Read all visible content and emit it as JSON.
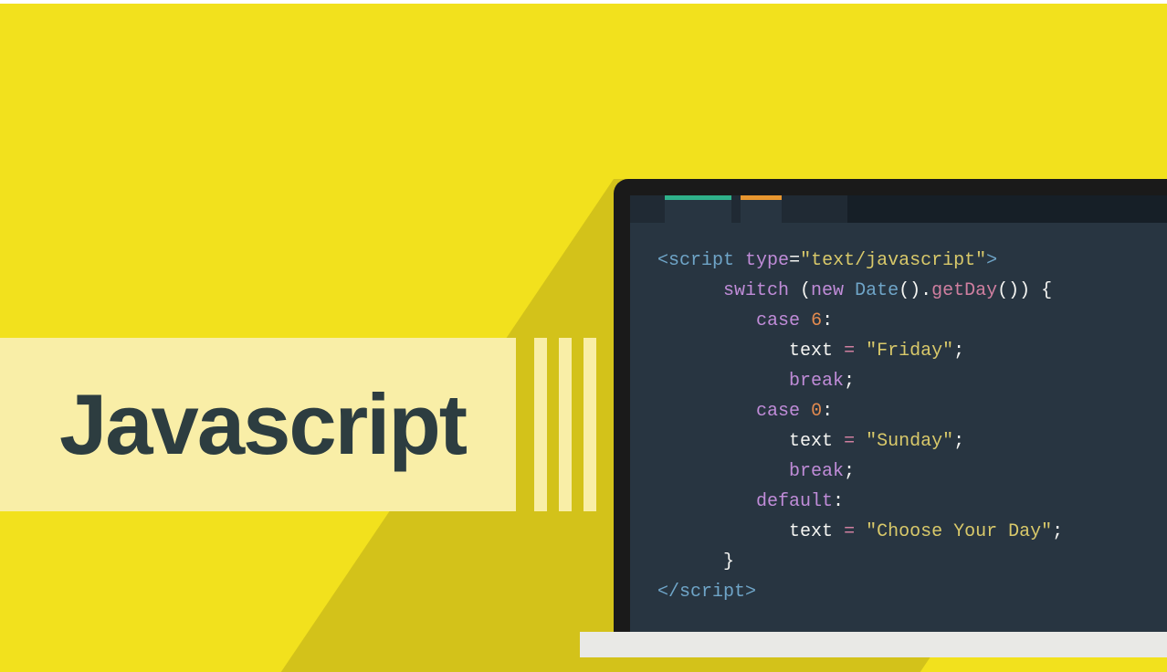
{
  "title": "Javascript",
  "code": {
    "line1": {
      "open_bracket": "<",
      "tag": "script",
      "space": " ",
      "attr_name": "type",
      "eq": "=",
      "attr_val": "\"text/javascript\"",
      "close_bracket": ">"
    },
    "line2": {
      "kw": "switch",
      "sp1": " (",
      "kw_new": "new",
      "sp2": " ",
      "cls": "Date",
      "call1": "().",
      "fn": "getDay",
      "call2": "()) {"
    },
    "line3": {
      "kw": "case",
      "sp": " ",
      "num": "6",
      "colon": ":"
    },
    "line4": {
      "var": "text",
      "sp": " ",
      "assign": "=",
      "sp2": " ",
      "str": "\"Friday\"",
      "semi": ";"
    },
    "line5": {
      "kw": "break",
      "semi": ";"
    },
    "line6": {
      "kw": "case",
      "sp": " ",
      "num": "0",
      "colon": ":"
    },
    "line7": {
      "var": "text",
      "sp": " ",
      "assign": "=",
      "sp2": " ",
      "str": "\"Sunday\"",
      "semi": ";"
    },
    "line8": {
      "kw": "break",
      "semi": ";"
    },
    "line9": {
      "kw": "default",
      "colon": ":"
    },
    "line10": {
      "var": "text",
      "sp": " ",
      "assign": "=",
      "sp2": " ",
      "str": "\"Choose Your Day\"",
      "semi": ";"
    },
    "line11": {
      "brace": "}"
    },
    "line12": {
      "open": "</",
      "tag": "script",
      "close": ">"
    }
  }
}
